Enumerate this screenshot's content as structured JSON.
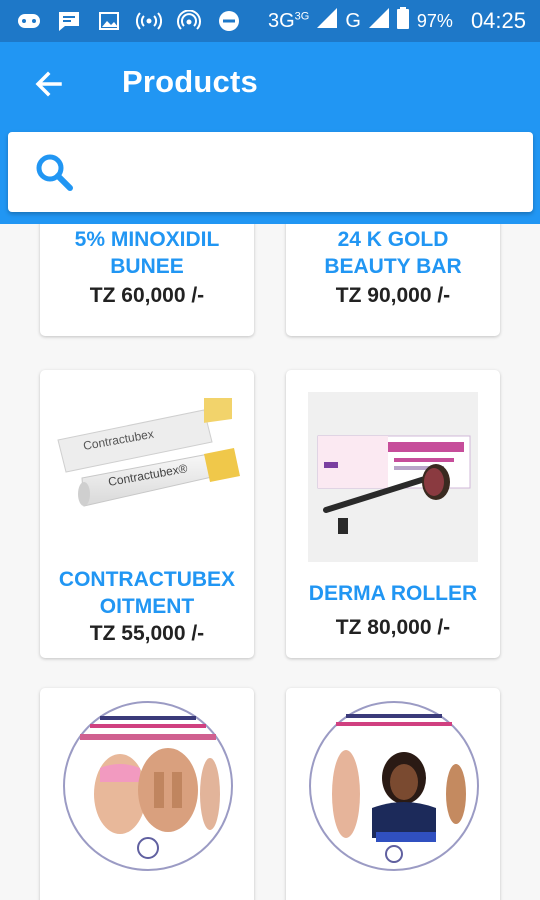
{
  "status_bar": {
    "network": "3G",
    "network_sup": "3G",
    "carrier": "G",
    "battery": "97%",
    "time": "04:25"
  },
  "app_bar": {
    "title": "Products",
    "back_icon": "arrow-back-icon"
  },
  "search": {
    "placeholder": "",
    "value": "",
    "icon": "search-icon"
  },
  "colors": {
    "primary": "#2196f3",
    "status_bar": "#1e78c8",
    "product_name": "#2196f3"
  },
  "products": [
    {
      "name_line1": "5% MINOXIDIL",
      "name_line2": "BUNEE",
      "price": "TZ 60,000 /-"
    },
    {
      "name_line1": "24 K GOLD",
      "name_line2": "BEAUTY BAR",
      "price": "TZ 90,000 /-"
    },
    {
      "name_line1": "CONTRACTUBEX",
      "name_line2": "OITMENT",
      "price": "TZ 55,000 /-"
    },
    {
      "name_line1": "DERMA ROLLER",
      "name_line2": "",
      "price": "TZ 80,000 /-"
    },
    {
      "name_line1": "",
      "name_line2": "",
      "price": ""
    },
    {
      "name_line1": "",
      "name_line2": "",
      "price": ""
    }
  ]
}
